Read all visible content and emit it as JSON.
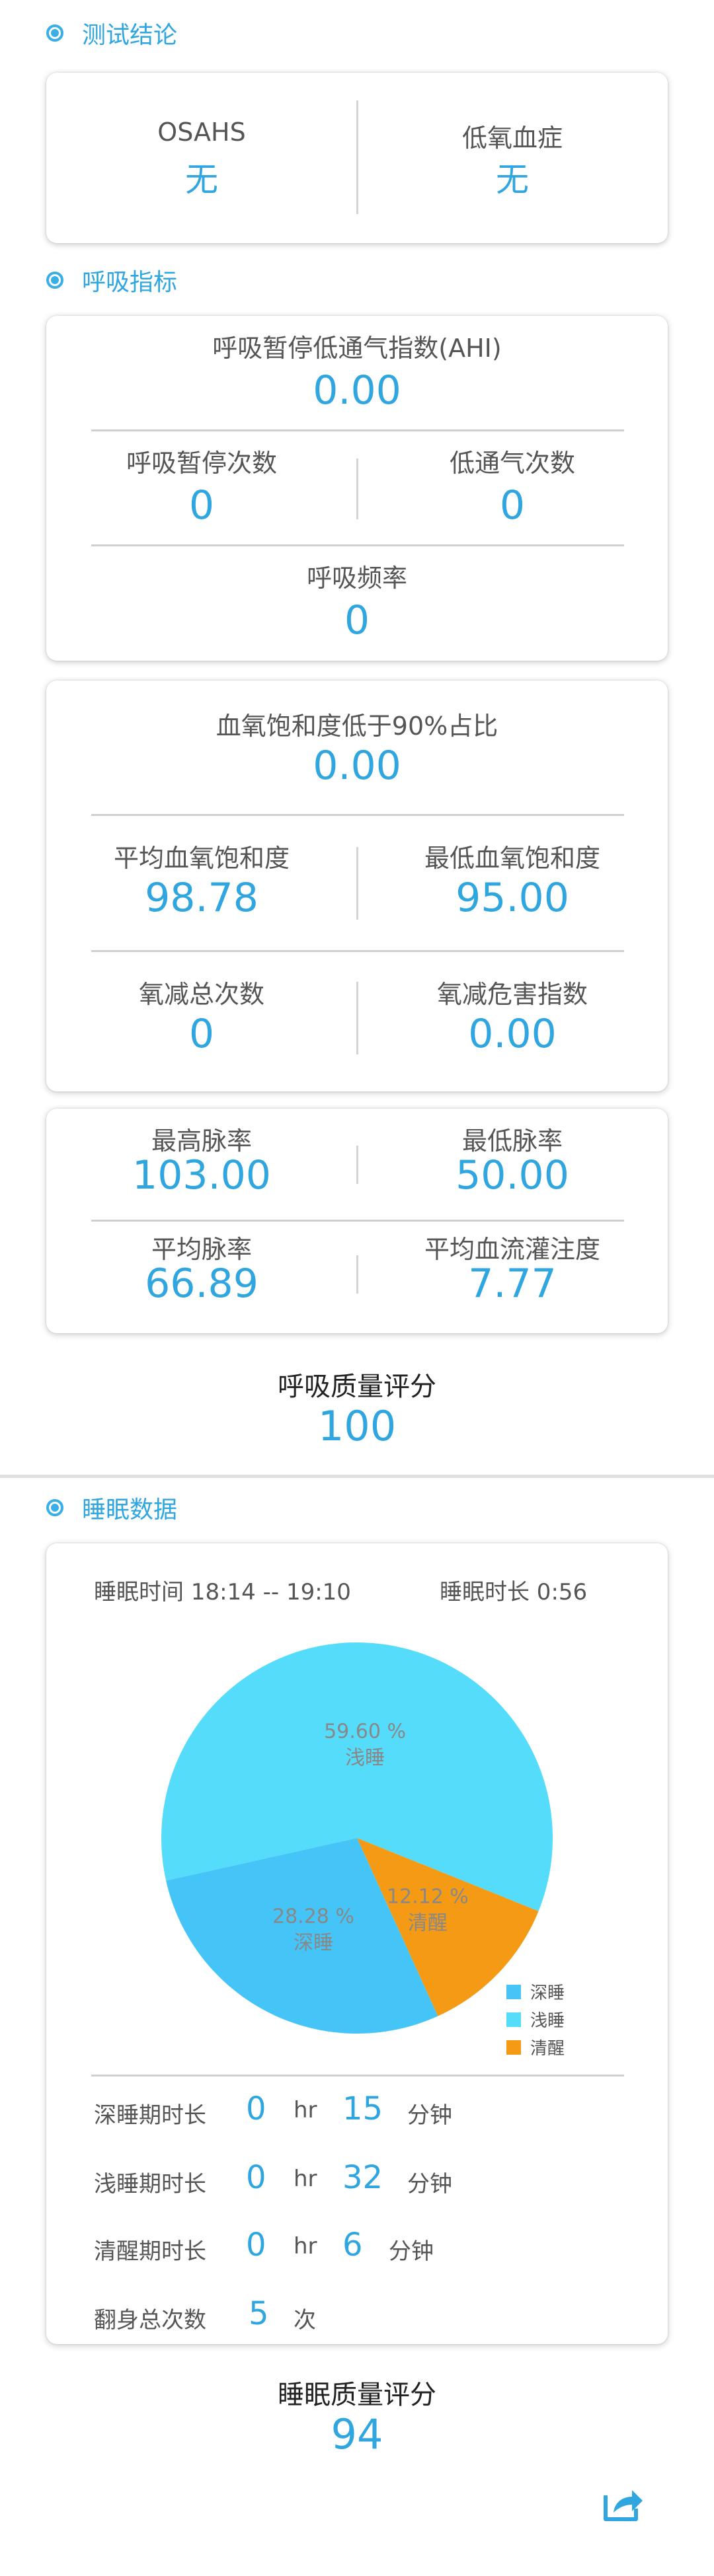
{
  "sections": {
    "conclusion": "测试结论",
    "breathing": "呼吸指标",
    "sleep": "睡眠数据"
  },
  "conclusion": {
    "osahs_label": "OSAHS",
    "osahs_value": "无",
    "hypoxemia_label": "低氧血症",
    "hypoxemia_value": "无"
  },
  "breathing": {
    "ahi_label": "呼吸暂停低通气指数(AHI)",
    "ahi_value": "0.00",
    "apnea_label": "呼吸暂停次数",
    "apnea_value": "0",
    "hypopnea_label": "低通气次数",
    "hypopnea_value": "0",
    "rate_label": "呼吸频率",
    "rate_value": "0"
  },
  "oxygen": {
    "below90_label": "血氧饱和度低于90%占比",
    "below90_value": "0.00",
    "avg_label": "平均血氧饱和度",
    "avg_value": "98.78",
    "min_label": "最低血氧饱和度",
    "min_value": "95.00",
    "desat_count_label": "氧减总次数",
    "desat_count_value": "0",
    "desat_index_label": "氧减危害指数",
    "desat_index_value": "0.00"
  },
  "pulse": {
    "max_label": "最高脉率",
    "max_value": "103.00",
    "min_label": "最低脉率",
    "min_value": "50.00",
    "avg_label": "平均脉率",
    "avg_value": "66.89",
    "perfusion_label": "平均血流灌注度",
    "perfusion_value": "7.77"
  },
  "breathing_score": {
    "label": "呼吸质量评分",
    "value": "100"
  },
  "sleep": {
    "time_range": "睡眠时间 18:14 -- 19:10",
    "duration": "睡眠时长 0:56",
    "deep_label": "深睡期时长",
    "deep_hr": "0",
    "deep_min": "15",
    "light_label": "浅睡期时长",
    "light_hr": "0",
    "light_min": "32",
    "awake_label": "清醒期时长",
    "awake_hr": "0",
    "awake_min": "6",
    "turn_label": "翻身总次数",
    "turn_value": "5",
    "turn_unit": "次",
    "unit_hr": "hr",
    "unit_min": "分钟"
  },
  "chart_data": {
    "type": "pie",
    "slices": [
      {
        "label": "浅睡",
        "percent": 59.6,
        "percent_text": "59.60 %",
        "color": "#55dcfa"
      },
      {
        "label": "清醒",
        "percent": 12.12,
        "percent_text": "12.12 %",
        "color": "#f49a14"
      },
      {
        "label": "深睡",
        "percent": 28.28,
        "percent_text": "28.28 %",
        "color": "#45c4f8"
      }
    ],
    "legend": [
      "深睡",
      "浅睡",
      "清醒"
    ],
    "legend_colors": [
      "#45c4f8",
      "#55dcfa",
      "#f49a14"
    ],
    "legend_position": "bottom-right"
  },
  "sleep_score": {
    "label": "睡眠质量评分",
    "value": "94"
  },
  "icons": {
    "share": "share-icon"
  }
}
